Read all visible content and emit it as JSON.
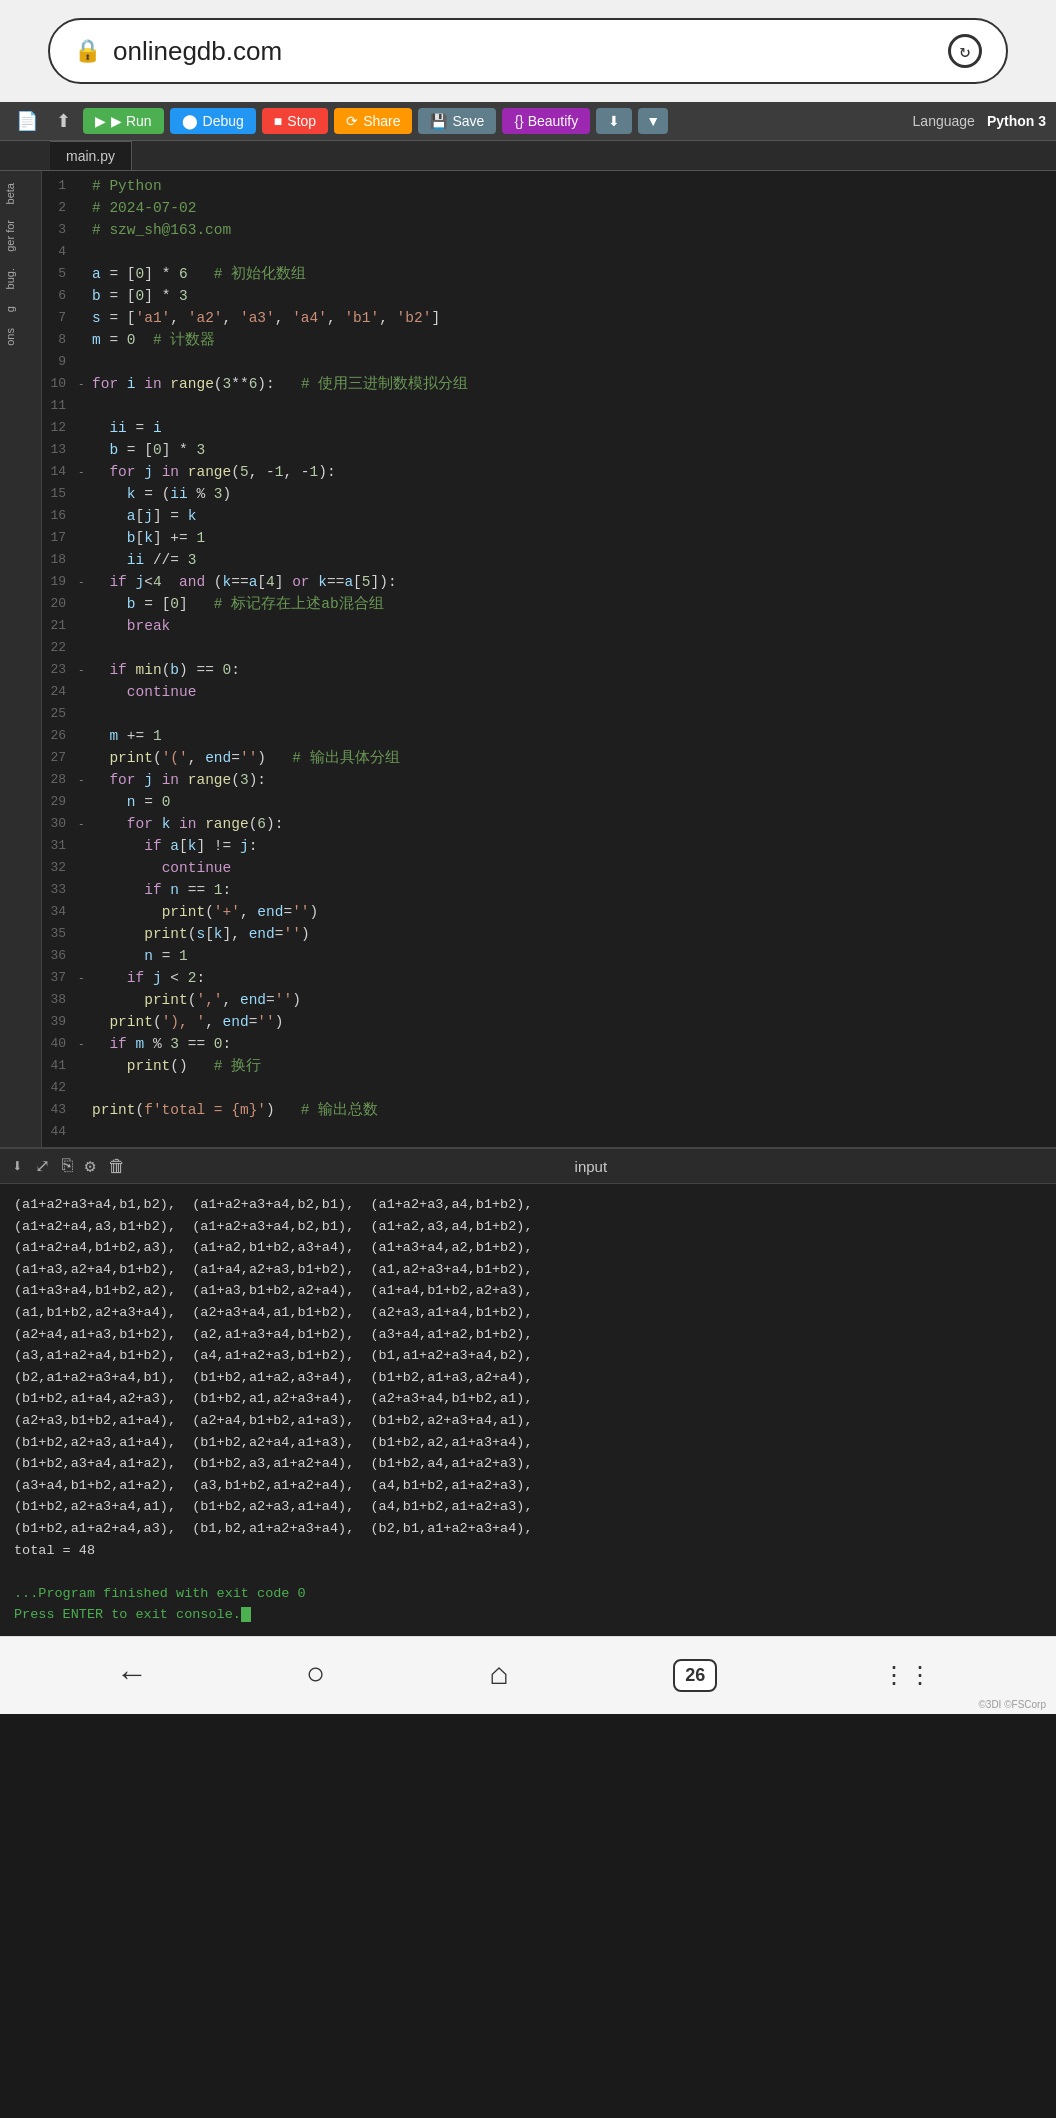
{
  "addressBar": {
    "url": "onlinegdb.com",
    "lockIcon": "🔒",
    "reloadIcon": "↻"
  },
  "toolbar": {
    "fileIcon": "📄",
    "arrowIcon": "↑",
    "runLabel": "▶ Run",
    "debugLabel": "⬤ Debug",
    "stopLabel": "■ Stop",
    "shareLabel": "⟳ Share",
    "saveLabel": "💾 Save",
    "beautifyLabel": "{} Beautify",
    "downloadIcon": "⬇",
    "dropdownIcon": "▼",
    "languageLabel": "Language",
    "languageValue": "Python 3"
  },
  "tabs": [
    {
      "label": "main.py"
    }
  ],
  "codeLines": [
    {
      "num": 1,
      "arrow": "",
      "code": "  # Python",
      "type": "comment"
    },
    {
      "num": 2,
      "arrow": "",
      "code": "  # 2024-07-02",
      "type": "comment"
    },
    {
      "num": 3,
      "arrow": "",
      "code": "  # szw_sh@163.com",
      "type": "comment"
    },
    {
      "num": 4,
      "arrow": "",
      "code": "",
      "type": "empty"
    },
    {
      "num": 5,
      "arrow": "",
      "code": "  a = [0] * 6   # 初始化数组",
      "type": "mixed"
    },
    {
      "num": 6,
      "arrow": "",
      "code": "  b = [0] * 3",
      "type": "code"
    },
    {
      "num": 7,
      "arrow": "",
      "code": "  s = ['a1', 'a2', 'a3', 'a4', 'b1', 'b2']",
      "type": "code"
    },
    {
      "num": 8,
      "arrow": "",
      "code": "  m = 0  # 计数器",
      "type": "mixed"
    },
    {
      "num": 9,
      "arrow": "",
      "code": "",
      "type": "empty"
    },
    {
      "num": 10,
      "arrow": "-",
      "code": "  for i in range(3**6):   # 使用三进制数模拟分组",
      "type": "mixed"
    },
    {
      "num": 11,
      "arrow": "",
      "code": "",
      "type": "empty"
    },
    {
      "num": 12,
      "arrow": "",
      "code": "    ii = i",
      "type": "code"
    },
    {
      "num": 13,
      "arrow": "",
      "code": "    b = [0] * 3",
      "type": "code"
    },
    {
      "num": 14,
      "arrow": "-",
      "code": "    for j in range(5, -1, -1):",
      "type": "code"
    },
    {
      "num": 15,
      "arrow": "",
      "code": "      k = (ii % 3)",
      "type": "code"
    },
    {
      "num": 16,
      "arrow": "",
      "code": "      a[j] = k",
      "type": "code"
    },
    {
      "num": 17,
      "arrow": "",
      "code": "      b[k] += 1",
      "type": "code"
    },
    {
      "num": 18,
      "arrow": "",
      "code": "      ii //= 3",
      "type": "code"
    },
    {
      "num": 19,
      "arrow": "-",
      "code": "    if j<4  and (k==a[4] or k==a[5]):",
      "type": "code"
    },
    {
      "num": 20,
      "arrow": "",
      "code": "      b = [0]   # 标记存在上述ab混合组",
      "type": "mixed"
    },
    {
      "num": 21,
      "arrow": "",
      "code": "      break",
      "type": "code"
    },
    {
      "num": 22,
      "arrow": "",
      "code": "",
      "type": "empty"
    },
    {
      "num": 23,
      "arrow": "-",
      "code": "    if min(b) == 0:",
      "type": "code"
    },
    {
      "num": 24,
      "arrow": "",
      "code": "      continue",
      "type": "code"
    },
    {
      "num": 25,
      "arrow": "",
      "code": "",
      "type": "empty"
    },
    {
      "num": 26,
      "arrow": "",
      "code": "    m += 1",
      "type": "code"
    },
    {
      "num": 27,
      "arrow": "",
      "code": "    print('(', end='')   # 输出具体分组",
      "type": "mixed"
    },
    {
      "num": 28,
      "arrow": "-",
      "code": "    for j in range(3):",
      "type": "code"
    },
    {
      "num": 29,
      "arrow": "",
      "code": "      n = 0",
      "type": "code"
    },
    {
      "num": 30,
      "arrow": "-",
      "code": "      for k in range(6):",
      "type": "code"
    },
    {
      "num": 31,
      "arrow": "",
      "code": "        if a[k] != j:",
      "type": "code"
    },
    {
      "num": 32,
      "arrow": "",
      "code": "          continue",
      "type": "code"
    },
    {
      "num": 33,
      "arrow": "",
      "code": "        if n == 1:",
      "type": "code"
    },
    {
      "num": 34,
      "arrow": "",
      "code": "          print('+', end='')",
      "type": "code"
    },
    {
      "num": 35,
      "arrow": "",
      "code": "        print(s[k], end='')",
      "type": "code"
    },
    {
      "num": 36,
      "arrow": "",
      "code": "        n = 1",
      "type": "code"
    },
    {
      "num": 37,
      "arrow": "-",
      "code": "      if j < 2:",
      "type": "code"
    },
    {
      "num": 38,
      "arrow": "",
      "code": "        print(',', end='')",
      "type": "code"
    },
    {
      "num": 39,
      "arrow": "",
      "code": "    print('), ', end='')",
      "type": "code"
    },
    {
      "num": 40,
      "arrow": "-",
      "code": "    if m % 3 == 0:",
      "type": "code"
    },
    {
      "num": 41,
      "arrow": "",
      "code": "      print()   # 换行",
      "type": "mixed"
    },
    {
      "num": 42,
      "arrow": "",
      "code": "",
      "type": "empty"
    },
    {
      "num": 43,
      "arrow": "",
      "code": "  print(f'total = {m}')   # 输出总数",
      "type": "mixed"
    },
    {
      "num": 44,
      "arrow": "",
      "code": "",
      "type": "empty"
    }
  ],
  "outputPanel": {
    "title": "input",
    "content": "(a1+a2+a3+a4,b1,b2), (a1+a2+a3+a4,b2,b1), (a1+a2+a3,a4,b1+b2),\n(a1+a2+a4,a3,b1+b2), (a1+a2+a3+a4,b2,b1), (a1+a2,a3,a4,b1+b2),\n(a1+a2+a4,b1+b2,a3), (a1+a2,b1+b2,a3+a4), (a1+a3+a4,a2,b1+b2),\n(a1+a3,a2+a4,b1+b2), (a1+a4,a2+a3,b1+b2), (a1,a2+a3+a4,b1+b2),\n(a1+a3+a4,b1+b2,a2), (a1+a3,b1+b2,a2+a4), (a1+a4,b1+b2,a2+a3),\n(a1,b1+b2,a2+a3+a4), (a2+a3+a4,a1,b1+b2), (a2+a3,a1+a4,b1+b2),\n(a2+a4,a1+a3,b1+b2), (a2,a1+a3+a4,b1+b2), (a3+a4,a1+a2,b1+b2),\n(a3,a1+a2+a4,b1+b2), (a4,a1+a2+a3,b1+b2), (b1,a1+a2+a3+a4,b2),\n(b2,a1+a2+a3+a4,b1), (b1+b2,a1+a2,a3+a4), (b1+b2,a1+a3,a2+a4),\n(b1+b2,a1+a4,a2+a3), (b1+b2,a1,a2+a3+a4), (a2+a3+a4,b1+b2,a1),\n(a2+a3,b1+b2,a1+a4), (a2+a4,b1+b2,a1+a3), (b1+b2,a2+a3+a4,a1),\n(b1+b2,a2+a3,a1+a4), (b1+b2,a2+a4,a1+a3), (b1+b2,a2,a1+a3+a4),\n(b1+b2,a3+a4,a1+a2), (b1+b2,a3,a1+a2+a4), (b1+b2,a4,a1+a2+a3),\n(a3+a4,b1+b2,a1+a2), (a3,b1+b2,a1+a2+a4), (a4,b1+b2,a1+a2+a3),\n(b1+b2,a2+a3+a4,a1), (b1+b2,a2+a3,a1+a4), (a4,b1+b2,a1+a2+a3),\n(b1+b2,a1+a2+a4,a3), (b1,b2,a1+a2+a3+a4), (b2,b1,a1+a2+a3+a4),\ntotal = 48",
    "exitMessage": "...Program finished with exit code 0",
    "enterMessage": "Press ENTER to exit console."
  },
  "bottomNav": {
    "backIcon": "←",
    "searchIcon": "○",
    "homeIcon": "⌂",
    "tabCount": "26",
    "moreIcon": "⋮⋮"
  },
  "sideLabels": [
    "beta",
    "ger for",
    "bug.",
    "g",
    "ons"
  ]
}
